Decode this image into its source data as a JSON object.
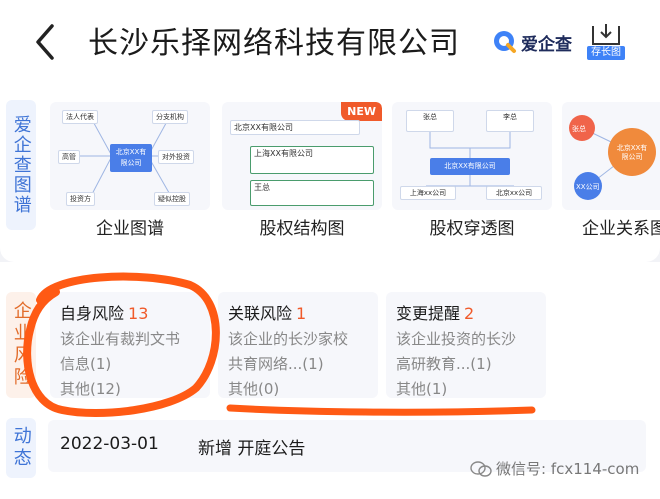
{
  "header": {
    "title": "长沙乐择网络科技有限公司",
    "brand": "爱企查",
    "save_label": "存长图"
  },
  "graph_section": {
    "side_label": "爱企查图谱",
    "items": [
      {
        "label": "企业图谱",
        "nodes": [
          "法人代表",
          "分支机构",
          "北京XX有限公司",
          "高管",
          "对外投资",
          "投资方",
          "疑似控股"
        ]
      },
      {
        "label": "股权结构图",
        "badge": "NEW",
        "nodes": [
          "北京XX有限公司",
          "上海XX有限公司",
          "王总"
        ]
      },
      {
        "label": "股权穿透图",
        "nodes": [
          "张总",
          "李总",
          "北京XX有限公司",
          "上海xx公司",
          "北京xx公司"
        ]
      },
      {
        "label": "企业关系图",
        "nodes": [
          "张总",
          "北京XX有限公司",
          "XX公司"
        ]
      }
    ]
  },
  "risk_section": {
    "side_label": "企业风险",
    "items": [
      {
        "title": "自身风险",
        "count": "13",
        "lines": [
          "该企业有裁判文书",
          "信息(1)",
          "其他(12)"
        ]
      },
      {
        "title": "关联风险",
        "count": "1",
        "lines": [
          "该企业的长沙家校",
          "共育网络...(1)",
          "其他(0)"
        ]
      },
      {
        "title": "变更提醒",
        "count": "2",
        "lines": [
          "该企业投资的长沙",
          "高研教育...(1)",
          "其他(1)"
        ]
      }
    ]
  },
  "dynamic_section": {
    "side_label": "动态",
    "date": "2022-03-01",
    "text": "新增  开庭公告"
  },
  "watermark": "微信号: fcx114-com",
  "colors": {
    "accent": "#3e82f7",
    "risk_count": "#f05a2a",
    "annotation": "#ff5a14"
  }
}
